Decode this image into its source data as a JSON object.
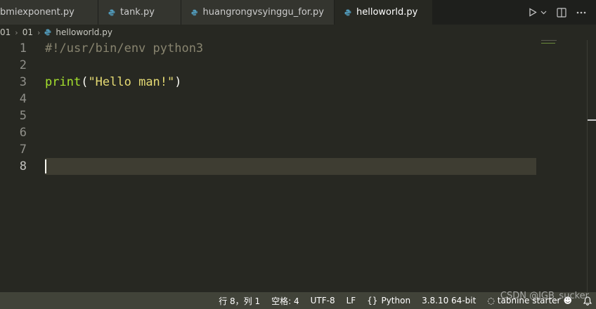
{
  "tabs": [
    {
      "label": "bmiexponent.py",
      "active": false
    },
    {
      "label": "tank.py",
      "active": false
    },
    {
      "label": "huangrongvsyinggu_for.py",
      "active": false
    },
    {
      "label": "helloworld.py",
      "active": true
    }
  ],
  "breadcrumb": {
    "seg1": "01",
    "seg2": "01",
    "file": "helloworld.py"
  },
  "editor": {
    "lines": [
      {
        "num": "1",
        "text": "#!/usr/bin/env python3"
      },
      {
        "num": "2",
        "text": ""
      },
      {
        "num": "3",
        "fn": "print",
        "open": "(",
        "str": "\"Hello man!\"",
        "close": ")"
      },
      {
        "num": "4",
        "text": ""
      },
      {
        "num": "5",
        "text": ""
      },
      {
        "num": "6",
        "text": ""
      },
      {
        "num": "7",
        "text": ""
      },
      {
        "num": "8",
        "text": ""
      }
    ]
  },
  "status": {
    "position": "行 8，列 1",
    "indent": "空格: 4",
    "encoding": "UTF-8",
    "eol": "LF",
    "language": "Python",
    "interpreter": "3.8.10 64-bit",
    "tabnine": "tabnine starter"
  },
  "watermark": "CSDN @JGB_sucker",
  "colors": {
    "editor_bg": "#272822",
    "comment": "#88846f",
    "function": "#a6e22e",
    "string": "#e6db74",
    "status_bg": "#414339"
  }
}
